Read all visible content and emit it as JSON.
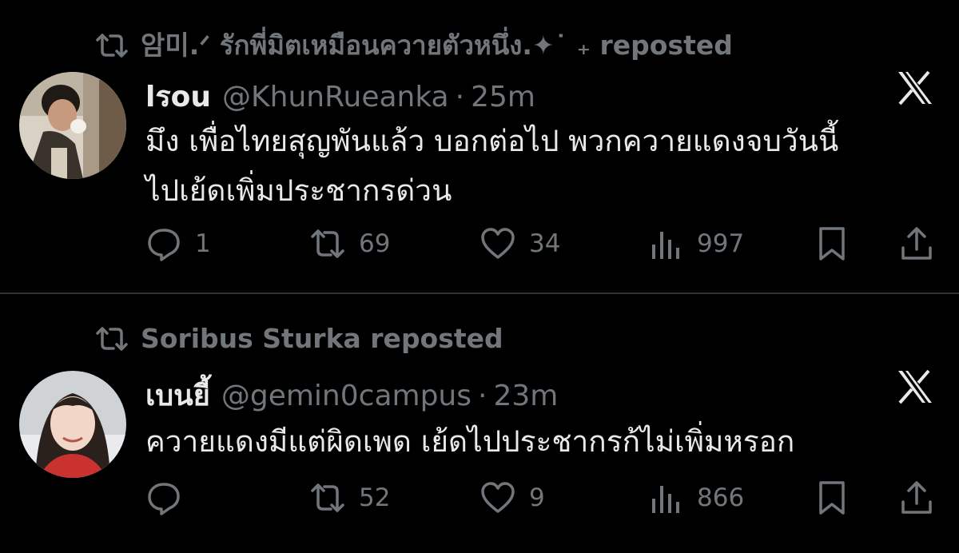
{
  "tweets": [
    {
      "repost_label": "암미.ᐟ รักพี่มิตเหมือนควายตัวหนึ่ง.✦˙ ₊ reposted",
      "display_name": "lรou",
      "handle": "@KhunRueanka",
      "separator": "·",
      "time": "25m",
      "text_lines": [
        "มึง เพื่อไทยสุญพันแล้ว บอกต่อไป พวกควายแดงจบวันนี้",
        "ไปเย้ดเพิ่มประชากรด่วน"
      ],
      "replies": "1",
      "reposts": "69",
      "likes": "34",
      "views": "997"
    },
    {
      "repost_label": "Soribus Sturka reposted",
      "display_name": "เบนยี้",
      "handle": "@gemin0campus",
      "separator": "·",
      "time": "23m",
      "text_lines": [
        "ควายแดงมีแต่ผิดเพด เย้ดไปประชากรก้ไม่เพิ่มหรอก"
      ],
      "replies": "",
      "reposts": "52",
      "likes": "9",
      "views": "866"
    }
  ],
  "icons": {
    "repost": "repost-icon",
    "reply": "reply-icon",
    "like": "heart-icon",
    "views": "views-icon",
    "bookmark": "bookmark-icon",
    "share": "share-icon",
    "brand": "x-logo-icon"
  },
  "colors": {
    "background": "#000000",
    "text": "#e7e9ea",
    "muted": "#71767b",
    "divider": "#2f3336"
  }
}
